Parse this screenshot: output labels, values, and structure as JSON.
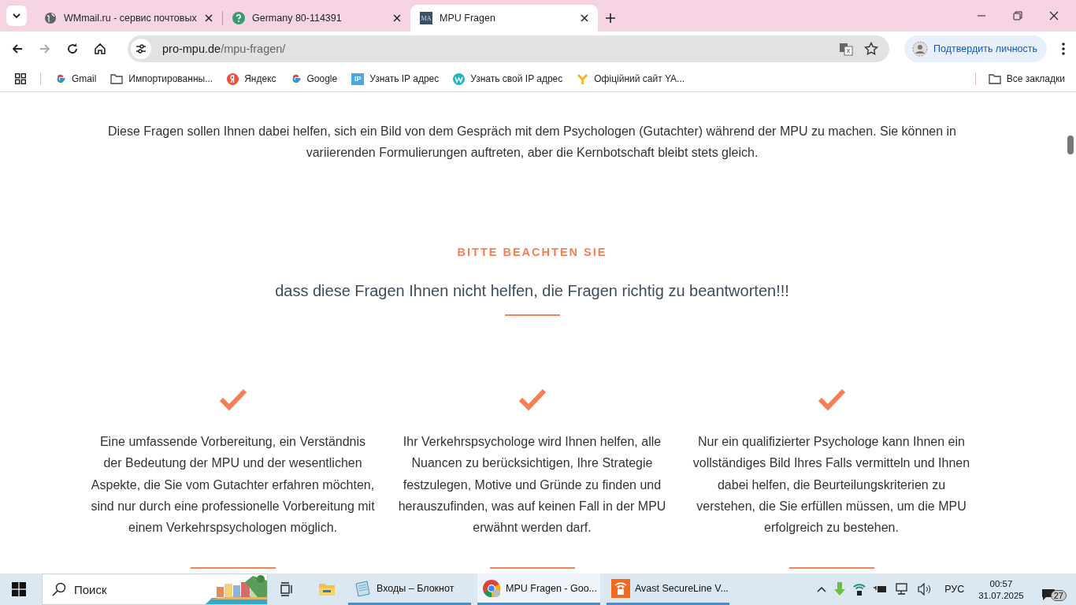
{
  "tabs": [
    {
      "title": "WMmail.ru - сервис почтовых",
      "kind": "globe",
      "selected": false
    },
    {
      "title": "Germany 80-114391",
      "kind": "help",
      "selected": false
    },
    {
      "title": "MPU Fragen",
      "kind": "site",
      "favicon_text": "MA",
      "selected": true
    }
  ],
  "address": {
    "host": "pro-mpu.de",
    "path": "/mpu-fragen/"
  },
  "profile_button": "Подтвердить личность",
  "bookmarks": [
    {
      "label": "Gmail",
      "kind": "google"
    },
    {
      "label": "Импортированны...",
      "kind": "folder"
    },
    {
      "label": "Яндекс",
      "kind": "yandex"
    },
    {
      "label": "Google",
      "kind": "google"
    },
    {
      "label": "Узнать IP адрес",
      "kind": "ip",
      "icon_text": "IP"
    },
    {
      "label": "Узнать свой IP адрес",
      "kind": "w"
    },
    {
      "label": "Офіційний сайт YA...",
      "kind": "y"
    }
  ],
  "all_bookmarks": "Все закладки",
  "page": {
    "intro": "Diese Fragen sollen Ihnen dabei helfen, sich ein Bild von dem Gespräch mit dem Psychologen (Gutachter) während der MPU zu machen. Sie können in variierenden Formulierungen auftreten, aber die Kernbotschaft bleibt stets gleich.",
    "notice_heading": "BITTE BEACHTEN SIE",
    "notice_text": "dass diese Fragen Ihnen nicht helfen, die Fragen richtig zu beantworten!!!",
    "columns": [
      {
        "text": "Eine umfassende Vorbereitung, ein Verständnis der Bedeutung der MPU und der wesentlichen Aspekte, die Sie vom Gutachter erfahren möchten, sind nur durch eine professionelle Vorbereitung mit einem Verkehrspsychologen möglich."
      },
      {
        "text": "Ihr Verkehrspsychologe wird Ihnen helfen, alle Nuancen zu berücksichtigen, Ihre Strategie festzulegen, Motive und Gründe zu finden und herauszufinden, was auf keinen Fall in der MPU erwähnt werden darf."
      },
      {
        "text": "Nur ein qualifizierter Psychologe kann Ihnen ein vollständiges Bild Ihres Falls vermitteln und Ihnen dabei helfen, die Beurteilungskriterien zu verstehen, die Sie erfüllen müssen, um die MPU erfolgreich zu bestehen."
      }
    ]
  },
  "taskbar": {
    "search_placeholder": "Поиск",
    "apps": [
      {
        "label": "Входы – Блокнот",
        "kind": "notepad",
        "selected": false
      },
      {
        "label": "MPU Fragen - Goo...",
        "kind": "chrome",
        "selected": true
      },
      {
        "label": "Avast SecureLine V...",
        "kind": "avast",
        "selected": false
      }
    ],
    "language": "РУС",
    "time": "00:57",
    "date": "31.07.2025",
    "notifications": "27"
  }
}
